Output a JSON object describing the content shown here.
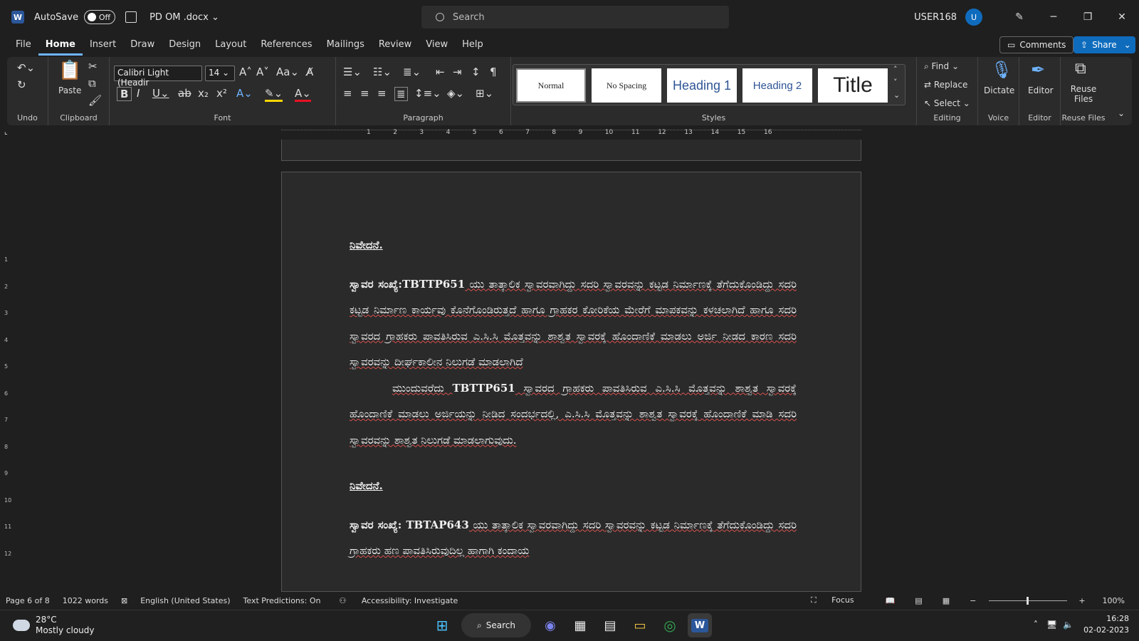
{
  "titlebar": {
    "autosave_label": "AutoSave",
    "autosave_state": "Off",
    "doc_name": "PD OM .docx",
    "search_placeholder": "Search",
    "user": "USER168",
    "avatar_initial": "U"
  },
  "menu": {
    "tabs": [
      "File",
      "Home",
      "Insert",
      "Draw",
      "Design",
      "Layout",
      "References",
      "Mailings",
      "Review",
      "View",
      "Help"
    ],
    "active": "Home",
    "comments_label": "Comments",
    "share_label": "Share"
  },
  "ribbon": {
    "undo_label": "Undo",
    "clipboard_label": "Clipboard",
    "paste_label": "Paste",
    "font_label": "Font",
    "font_name": "Calibri Light (Headir",
    "font_size": "14",
    "paragraph_label": "Paragraph",
    "styles_label": "Styles",
    "styles": [
      "Normal",
      "No Spacing",
      "Heading 1",
      "Heading 2",
      "Title"
    ],
    "find_label": "Find",
    "replace_label": "Replace",
    "select_label": "Select",
    "editing_label": "Editing",
    "dictate_label": "Dictate",
    "voice_label": "Voice",
    "editor_label": "Editor",
    "editor_group_label": "Editor",
    "reuse_files_label": "Reuse Files",
    "reuse_group_label": "Reuse Files"
  },
  "document": {
    "heading1": "ನಿವೇದನೆ.",
    "para1_lead": "ಸ್ವಾವರ ಸಂಖ್ಯೆ:",
    "para1_code": "TBTTP651",
    "para1_rest": " ಯು ತಾತ್ಕಾಲಿಕ ಸ್ವಾವರವಾಗಿದ್ದು ಸದರಿ ಸ್ವಾವರವನ್ನು ಕಟ್ಟಡ ನಿರ್ಮಾಣಕ್ಕೆ ತೆಗೆದುಕೊಂಡಿದ್ದು ಸದರಿ ಕಟ್ಟಡ ನಿರ್ಮಾಣ ಕಾರ್ಯವು ಕೊನೆಗೊಂಡಿರುತ್ತದೆ ಹಾಗೂ ಗ್ರಾಹಕರ ಕೋರಿಕೆಯ ಮೇರೆಗೆ ಮಾಪಕವನ್ನು ಕಳಚಲಾಗಿದೆ ಹಾಗೂ ಸದರಿ ಸ್ವಾವರದ ಗ್ರಾಹಕರು ಪಾವತಿಸಿರುವ ಎ.ಸಿ.ಸಿ ಮೊತ್ತವನ್ನು ಶಾಶ್ವತ ಸ್ವಾವರಕ್ಕೆ ಹೊಂದಾಣಿಕೆ ಮಾಡಲು ಅರ್ಜಿ ನೀಡದ ಕಾರಣ ಸದರಿ ಸ್ವಾವರವನ್ನು ದೀರ್ಘಕಾಲೀನ ನಿಲುಗಡೆ ಮಾಡಲಾಗಿದೆ",
    "para2_lead": "ಮುಂದುವರೆದು ",
    "para2_code": "TBTTP651",
    "para2_rest": " ಸ್ವಾವರದ ಗ್ರಾಹಕರು ಪಾವತಿಸಿರುವ ಎ.ಸಿ.ಸಿ ಮೊತ್ತವನ್ನು ಶಾಶ್ವತ ಸ್ವಾವರಕ್ಕೆ ಹೊಂದಾಣಿಕೆ ಮಾಡಲು ಅರ್ಜಿಯನ್ನು ನೀಡಿದ ಸಂದರ್ಭದಲ್ಲಿ, ಎ.ಸಿ.ಸಿ ಮೊತ್ತವನ್ನು ಶಾಶ್ವತ ಸ್ವಾವರಕ್ಕೆ ಹೊಂದಾಣಿಕೆ ಮಾಡಿ ಸದರಿ ಸ್ವಾವರವನ್ನು ಶಾಶ್ವತ ನಿಲುಗಡೆ ಮಾಡಲಾಗುವುದು.",
    "heading2": "ನಿವೇದನೆ.",
    "para3_lead": "ಸ್ವಾವರ ಸಂಖ್ಯೆ: ",
    "para3_code": "TBTAP643",
    "para3_rest": " ಯು ತಾತ್ಕಾಲಿಕ ಸ್ವಾವರವಾಗಿದ್ದು ಸದರಿ ಸ್ವಾವರವನ್ನು ಕಟ್ಟಡ ನಿರ್ಮಾಣಕ್ಕೆ ತೆಗೆದುಕೊಂಡಿದ್ದು ಸದರಿ ಗ್ರಾಹಕರು ಹಣ ಪಾವತಿಸಿರುವುದಿಲ್ಲ ಹಾಗಾಗಿ ಕಂದಾಯ"
  },
  "ruler": {
    "ticks": [
      "1",
      "2",
      "3",
      "4",
      "5",
      "6",
      "7",
      "8",
      "9",
      "10",
      "11",
      "12",
      "13",
      "14",
      "15",
      "16"
    ],
    "vticks": [
      "1",
      "2",
      "3",
      "4",
      "5",
      "6",
      "7",
      "8",
      "9",
      "10",
      "11",
      "12"
    ]
  },
  "status": {
    "page": "Page 6 of 8",
    "words": "1022 words",
    "language": "English (United States)",
    "predictions": "Text Predictions: On",
    "accessibility": "Accessibility: Investigate",
    "focus": "Focus",
    "zoom": "100%"
  },
  "taskbar": {
    "temp": "28°C",
    "weather": "Mostly cloudy",
    "search_label": "Search",
    "time": "16:28",
    "date": "02-02-2023"
  }
}
